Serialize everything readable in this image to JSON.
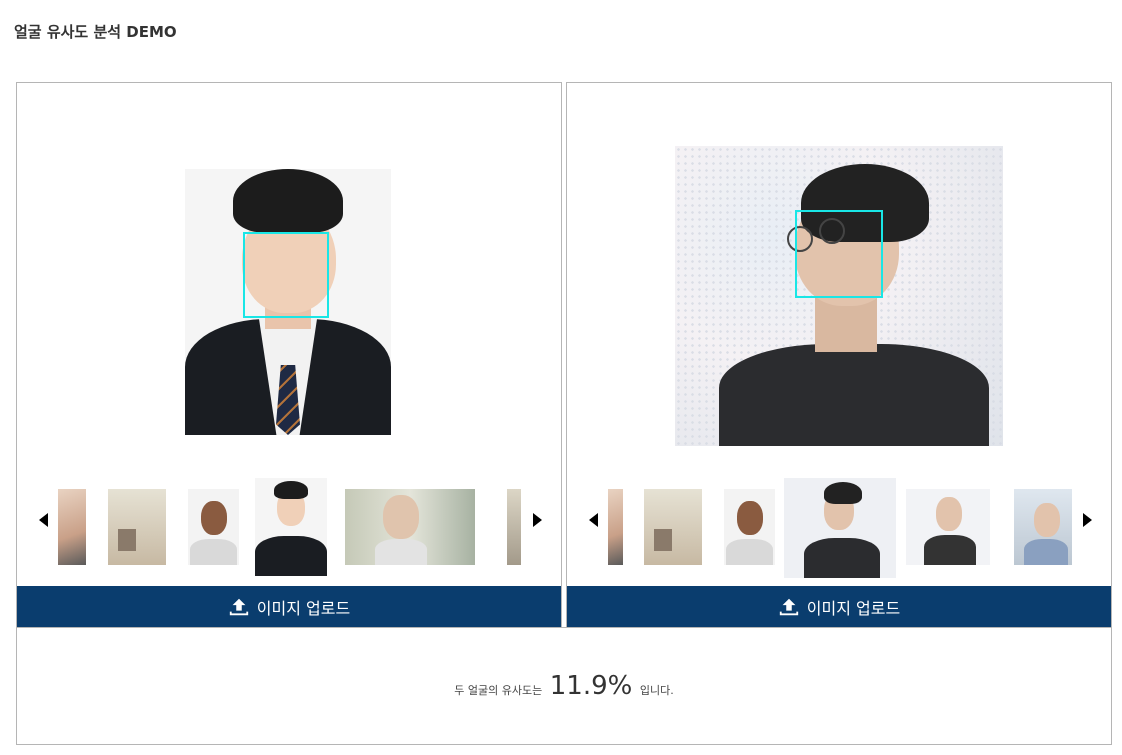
{
  "header": {
    "title": "얼굴 유사도 분석 DEMO"
  },
  "panels": {
    "left": {
      "upload_label": "이미지 업로드",
      "thumbnails": [
        "thumb-1",
        "thumb-2",
        "thumb-3",
        "thumb-4",
        "thumb-5",
        "thumb-6"
      ],
      "selected_index": 3
    },
    "right": {
      "upload_label": "이미지 업로드",
      "thumbnails": [
        "thumb-1",
        "thumb-2",
        "thumb-3",
        "thumb-4",
        "thumb-5",
        "thumb-6"
      ],
      "selected_index": 3
    }
  },
  "result": {
    "prefix": "두 얼굴의 유사도는",
    "value": "11.9%",
    "suffix": "입니다."
  },
  "colors": {
    "accent": "#0a3d6e",
    "face_box": "#19e6e6",
    "border": "#b5b5b5"
  },
  "icons": {
    "upload": "upload-icon",
    "prev": "caret-left-icon",
    "next": "caret-right-icon"
  }
}
